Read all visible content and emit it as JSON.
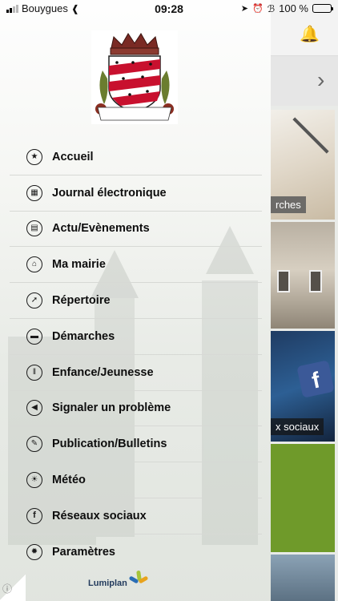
{
  "status_bar": {
    "carrier": "Bouygues",
    "time": "09:28",
    "battery": "100 %",
    "icons": [
      "signal-icon",
      "wifi-icon",
      "location-icon",
      "alarm-icon",
      "bluetooth-icon",
      "battery-icon"
    ]
  },
  "background": {
    "icons": [
      "bell-icon",
      "chevron-right-icon"
    ],
    "tiles": [
      {
        "caption": "rches"
      },
      {
        "caption": ""
      },
      {
        "caption": "x sociaux"
      },
      {
        "caption": ""
      },
      {
        "caption": ""
      }
    ]
  },
  "crest": {
    "motto_left": "Bonny",
    "motto_mid": "sur",
    "motto_right": "Loire"
  },
  "menu": {
    "items": [
      {
        "label": "Accueil",
        "icon": "star-icon"
      },
      {
        "label": "Journal électronique",
        "icon": "screen-icon"
      },
      {
        "label": "Actu/Evènements",
        "icon": "calendar-icon"
      },
      {
        "label": "Ma mairie",
        "icon": "town-hall-icon"
      },
      {
        "label": "Répertoire",
        "icon": "compass-icon"
      },
      {
        "label": "Démarches",
        "icon": "speech-bubble-icon"
      },
      {
        "label": "Enfance/Jeunesse",
        "icon": "cutlery-icon"
      },
      {
        "label": "Signaler un problème",
        "icon": "megaphone-icon"
      },
      {
        "label": "Publication/Bulletins",
        "icon": "pen-icon"
      },
      {
        "label": "Météo",
        "icon": "weather-icon"
      },
      {
        "label": "Réseaux sociaux",
        "icon": "facebook-icon"
      },
      {
        "label": "Paramètres",
        "icon": "settings-icon"
      }
    ]
  },
  "footer": {
    "brand": "Lumiplan"
  },
  "colors": {
    "brand_red": "#c8102e",
    "brand_navy": "#233b5d",
    "facebook_blue": "#3b5998",
    "tile_green": "#6f9a2a"
  }
}
